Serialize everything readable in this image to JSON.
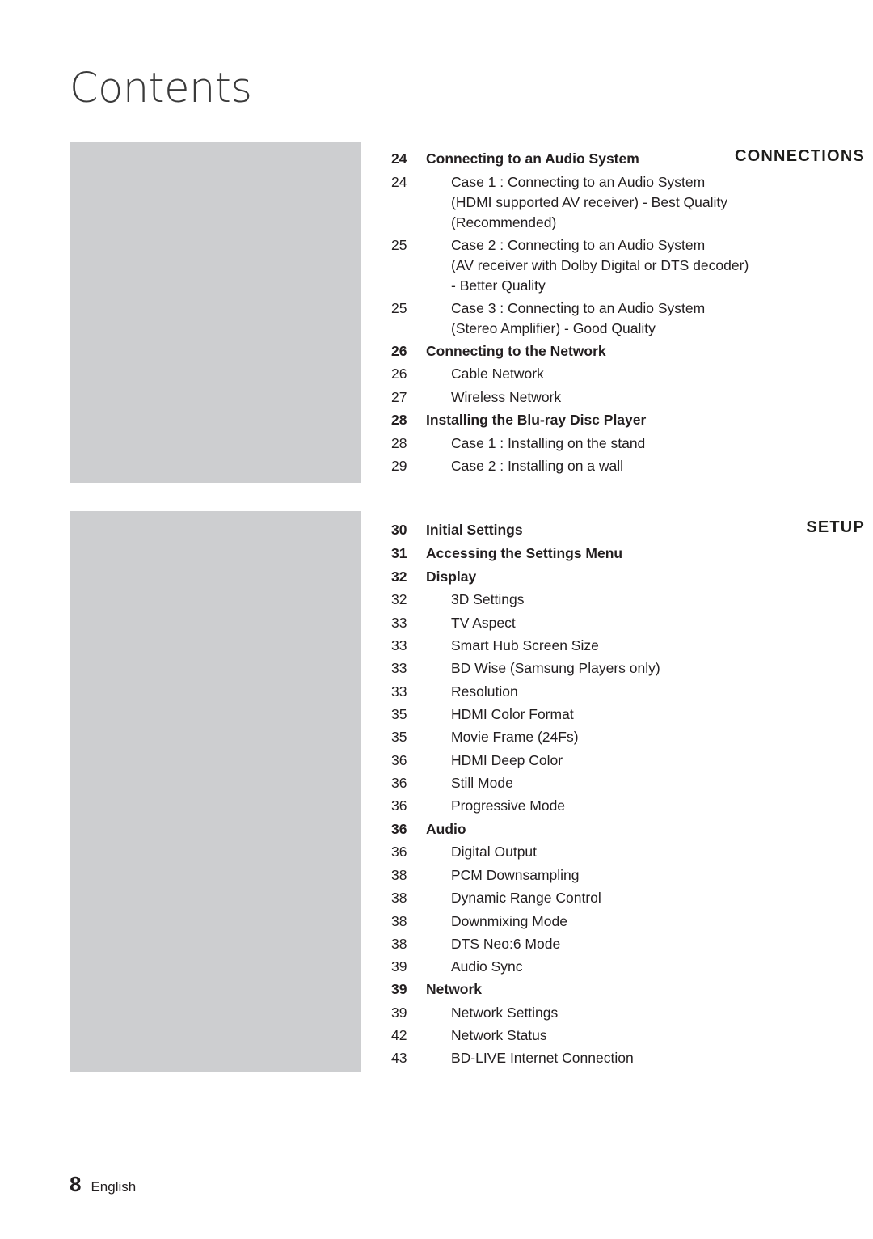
{
  "document": {
    "title": "Contents",
    "footer": {
      "page_number": "8",
      "language": "English"
    }
  },
  "sections": [
    {
      "id": "connections",
      "label": "CONNECTIONS"
    },
    {
      "id": "setup",
      "label": "SETUP"
    }
  ],
  "entries": [
    {
      "page": "24",
      "text": "Connecting to an Audio System",
      "level": 1
    },
    {
      "page": "24",
      "text": "Case 1 : Connecting to an Audio System",
      "level": 2
    },
    {
      "page": "",
      "text": "(HDMI supported AV receiver) - Best Quality",
      "level": 2
    },
    {
      "page": "",
      "text": "(Recommended)",
      "level": 2
    },
    {
      "page": "25",
      "text": "Case 2 : Connecting to an Audio System",
      "level": 2
    },
    {
      "page": "",
      "text": "(AV receiver with Dolby Digital or DTS decoder)",
      "level": 2
    },
    {
      "page": "",
      "text": "- Better Quality",
      "level": 2
    },
    {
      "page": "25",
      "text": "Case 3 : Connecting to an Audio System",
      "level": 2
    },
    {
      "page": "",
      "text": "(Stereo Amplifier) - Good Quality",
      "level": 2
    },
    {
      "page": "26",
      "text": "Connecting to the Network",
      "level": 1
    },
    {
      "page": "26",
      "text": "Cable Network",
      "level": 2
    },
    {
      "page": "27",
      "text": "Wireless Network",
      "level": 2
    },
    {
      "page": "28",
      "text": "Installing the Blu-ray Disc Player",
      "level": 1
    },
    {
      "page": "28",
      "text": "Case 1 : Installing on the stand",
      "level": 2
    },
    {
      "page": "29",
      "text": "Case 2 : Installing on a wall",
      "level": 2
    },
    {
      "page": "30",
      "text": "Initial Settings",
      "level": 1
    },
    {
      "page": "31",
      "text": "Accessing the Settings Menu",
      "level": 1
    },
    {
      "page": "32",
      "text": "Display",
      "level": 1
    },
    {
      "page": "32",
      "text": "3D Settings",
      "level": 2
    },
    {
      "page": "33",
      "text": "TV Aspect",
      "level": 2
    },
    {
      "page": "33",
      "text": "Smart Hub Screen Size",
      "level": 2
    },
    {
      "page": "33",
      "text": "BD Wise (Samsung Players only)",
      "level": 2
    },
    {
      "page": "33",
      "text": "Resolution",
      "level": 2
    },
    {
      "page": "35",
      "text": "HDMI Color Format",
      "level": 2
    },
    {
      "page": "35",
      "text": "Movie Frame (24Fs)",
      "level": 2
    },
    {
      "page": "36",
      "text": "HDMI Deep Color",
      "level": 2
    },
    {
      "page": "36",
      "text": "Still Mode",
      "level": 2
    },
    {
      "page": "36",
      "text": "Progressive Mode",
      "level": 2
    },
    {
      "page": "36",
      "text": "Audio",
      "level": 1
    },
    {
      "page": "36",
      "text": "Digital Output",
      "level": 2
    },
    {
      "page": "38",
      "text": "PCM Downsampling",
      "level": 2
    },
    {
      "page": "38",
      "text": "Dynamic Range Control",
      "level": 2
    },
    {
      "page": "38",
      "text": "Downmixing Mode",
      "level": 2
    },
    {
      "page": "38",
      "text": "DTS Neo:6 Mode",
      "level": 2
    },
    {
      "page": "39",
      "text": "Audio Sync",
      "level": 2
    },
    {
      "page": "39",
      "text": "Network",
      "level": 1
    },
    {
      "page": "39",
      "text": "Network Settings",
      "level": 2
    },
    {
      "page": "42",
      "text": "Network Status",
      "level": 2
    },
    {
      "page": "43",
      "text": "BD-LIVE Internet Connection",
      "level": 2
    }
  ]
}
